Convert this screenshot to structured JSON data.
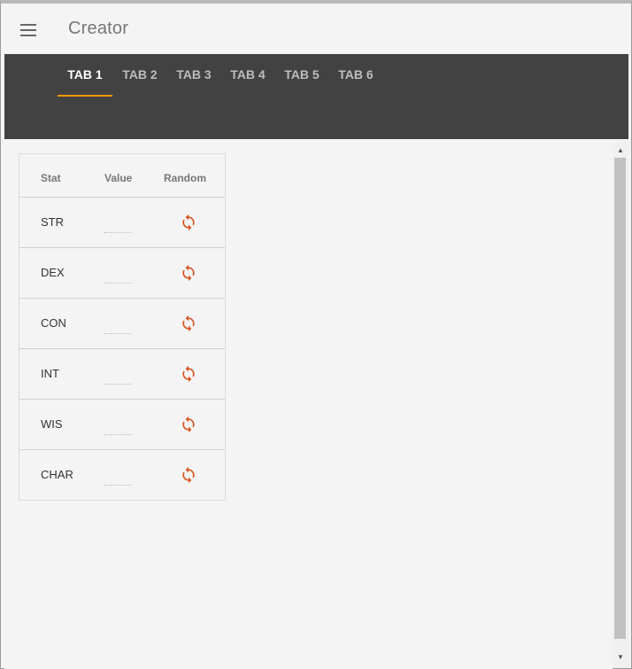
{
  "app": {
    "title": "Creator"
  },
  "tabs": [
    {
      "label": "TAB 1",
      "active": true
    },
    {
      "label": "TAB 2",
      "active": false
    },
    {
      "label": "TAB 3",
      "active": false
    },
    {
      "label": "TAB 4",
      "active": false
    },
    {
      "label": "TAB 5",
      "active": false
    },
    {
      "label": "TAB 6",
      "active": false
    }
  ],
  "table": {
    "headers": {
      "stat": "Stat",
      "value": "Value",
      "random": "Random"
    },
    "rows": [
      {
        "stat": "STR",
        "value": ""
      },
      {
        "stat": "DEX",
        "value": ""
      },
      {
        "stat": "CON",
        "value": ""
      },
      {
        "stat": "INT",
        "value": ""
      },
      {
        "stat": "WIS",
        "value": ""
      },
      {
        "stat": "CHAR",
        "value": ""
      }
    ]
  },
  "icons": {
    "menu": "menu-icon",
    "refresh": "refresh-icon"
  },
  "colors": {
    "accent": "#ff9800",
    "refresh": "#d9531e",
    "tabbar": "#424242"
  }
}
